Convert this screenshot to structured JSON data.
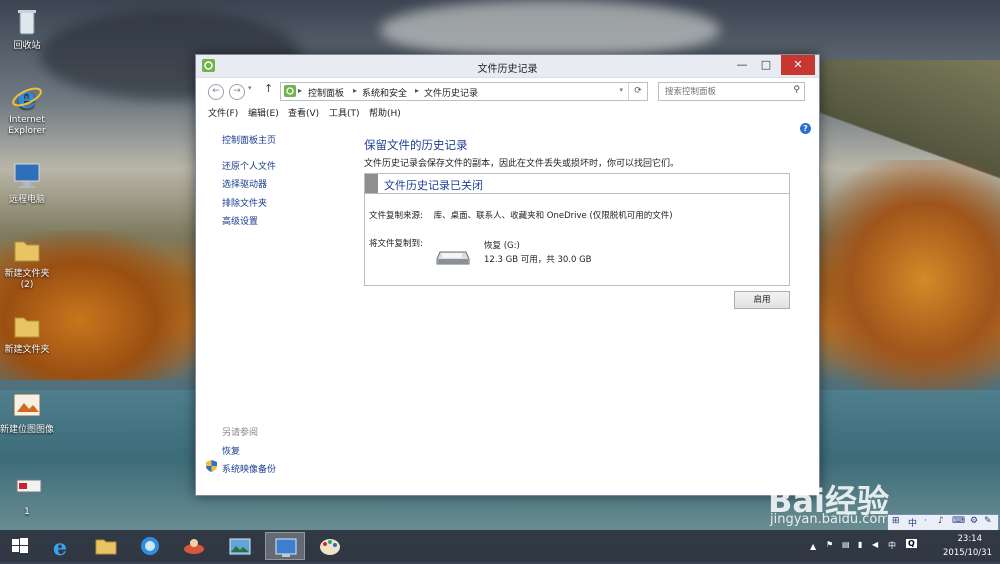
{
  "desktop": {
    "icons": [
      {
        "label": "回收站",
        "icon": "recycle-bin-icon"
      },
      {
        "label": "Internet Explorer",
        "icon": "ie-icon"
      },
      {
        "label": "远程电脑",
        "icon": "computer-icon"
      },
      {
        "label": "新建文件夹\n(2)",
        "icon": "folder-icon"
      },
      {
        "label": "新建文件夹",
        "icon": "folder-icon"
      },
      {
        "label": "新建位图图像",
        "icon": "bitmap-icon"
      },
      {
        "label": "1",
        "icon": "file-icon"
      }
    ]
  },
  "window": {
    "title": "文件历史记录",
    "minimize": "—",
    "maximize": "□",
    "close": "✕"
  },
  "address": {
    "crumbs": [
      "控制面板",
      "系统和安全",
      "文件历史记录"
    ],
    "search_placeholder": "搜索控制面板"
  },
  "menu": [
    "文件(F)",
    "编辑(E)",
    "查看(V)",
    "工具(T)",
    "帮助(H)"
  ],
  "sidebar": {
    "home": "控制面板主页",
    "links": [
      "还原个人文件",
      "选择驱动器",
      "排除文件夹",
      "高级设置"
    ],
    "see_also_title": "另请参阅",
    "see_also": [
      "恢复",
      "系统映像备份"
    ]
  },
  "main": {
    "title": "保留文件的历史记录",
    "description": "文件历史记录会保存文件的副本，因此在文件丢失或损坏时，你可以找回它们。",
    "status_title": "文件历史记录已关闭",
    "copy_from_label": "文件复制来源:",
    "copy_from_value": "库、桌面、联系人、收藏夹和 OneDrive (仅限脱机可用的文件)",
    "copy_to_label": "将文件复制到:",
    "drive_name": "恢复 (G:)",
    "drive_space": "12.3 GB 可用，共 30.0 GB",
    "enable_button": "启用"
  },
  "taskbar": {
    "time": "23:14",
    "date": "2015/10/31",
    "ime": [
      "中",
      "·",
      "♪",
      "⌨"
    ]
  },
  "watermark": {
    "brand": "Bai经验",
    "url": "jingyan.baidu.com"
  }
}
